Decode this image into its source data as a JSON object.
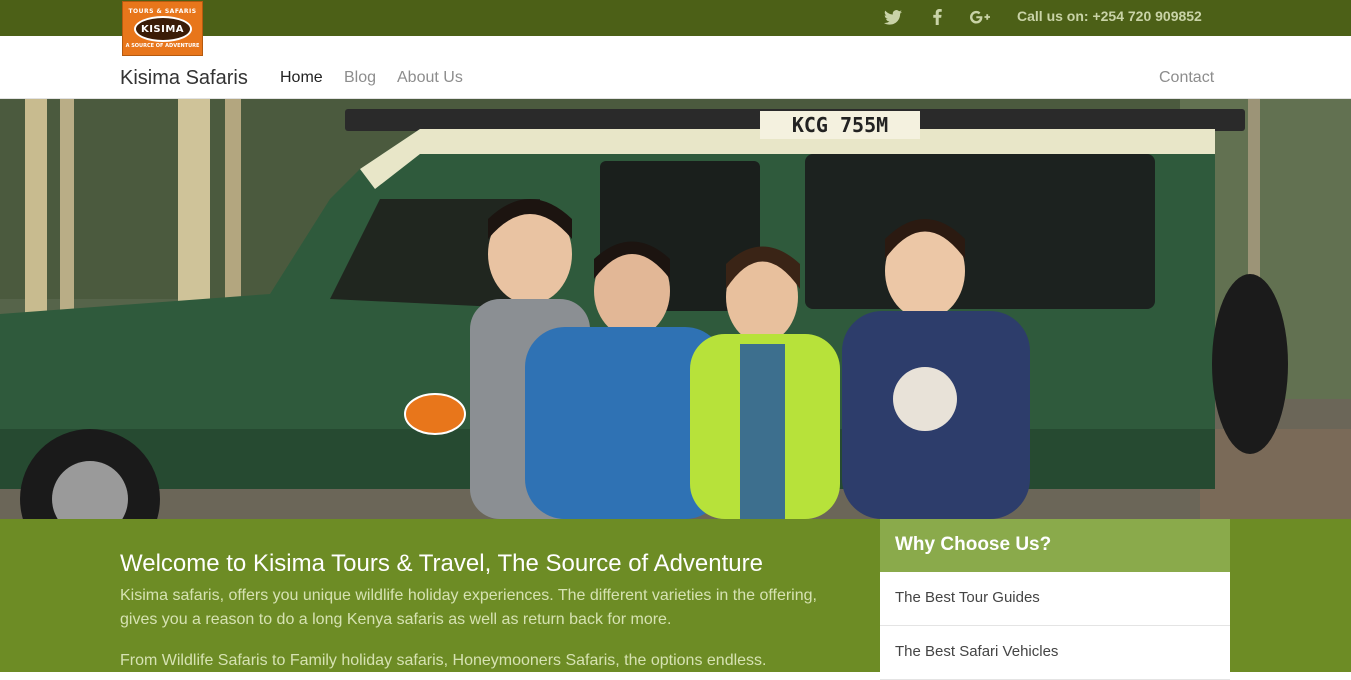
{
  "topbar": {
    "logo": {
      "arc_top": "TOURS & SAFARIS",
      "name": "KISIMA",
      "arc_bottom": "A SOURCE OF ADVENTURE"
    },
    "social": [
      {
        "icon": "twitter-icon"
      },
      {
        "icon": "facebook-icon"
      },
      {
        "icon": "google-plus-icon"
      }
    ],
    "call_text": "Call us on: +254 720 909852"
  },
  "nav": {
    "brand": "Kisima Safaris",
    "links": [
      "Home",
      "Blog",
      "About Us"
    ],
    "contact": "Contact"
  },
  "hero": {
    "plate": "KCG 755M"
  },
  "welcome": {
    "title": "Welcome to Kisima Tours & Travel, The Source of Adventure",
    "p1": "Kisima safaris, offers you unique wildlife holiday experiences. The different varieties in the offering, gives you a reason to do a long Kenya safaris as well as return back for more.",
    "p2": "From Wildlife Safaris to Family holiday safaris, Honeymooners Safaris, the options endless."
  },
  "why": {
    "title": "Why Choose Us?",
    "items": [
      "The Best Tour Guides",
      "The Best Safari Vehicles"
    ]
  },
  "colors": {
    "topbar": "#4c6017",
    "content": "#6d8c25",
    "why_header": "#8aaa4b",
    "logo": "#e8761b"
  }
}
